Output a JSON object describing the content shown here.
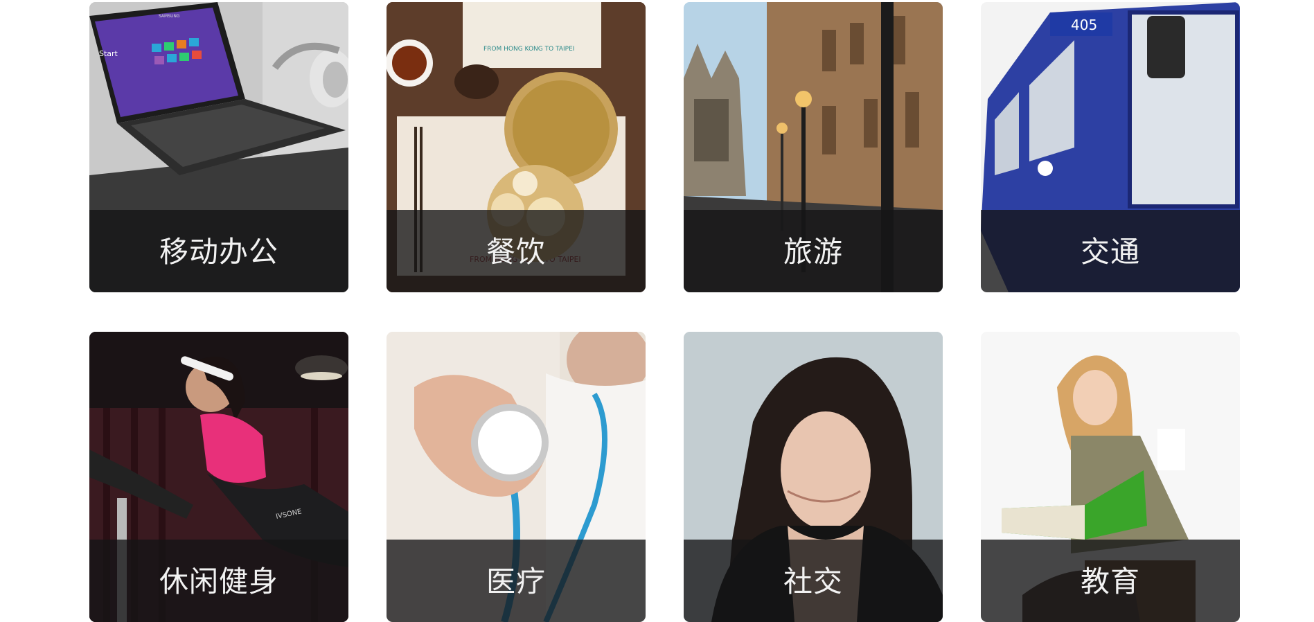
{
  "tiles": [
    {
      "label": "移动办公",
      "scene": "laptop with tiles screen, headphones"
    },
    {
      "label": "餐饮",
      "scene": "dim sum steamer basket, tea, placemat"
    },
    {
      "label": "旅游",
      "scene": "gothic street with lamp posts"
    },
    {
      "label": "交通",
      "scene": "blue bus number 405"
    },
    {
      "label": "休闲健身",
      "scene": "woman on exercise bike"
    },
    {
      "label": "医疗",
      "scene": "doctor holding stethoscope"
    },
    {
      "label": "社交",
      "scene": "woman looking at phone"
    },
    {
      "label": "教育",
      "scene": "girl reading green book"
    }
  ],
  "bus_number": "405",
  "placemat_text": "FROM HONG KONG TO TAIPEI",
  "laptop_brand": "SAMSUNG",
  "laptop_start": "Start",
  "bike_brand": "IVSONE"
}
